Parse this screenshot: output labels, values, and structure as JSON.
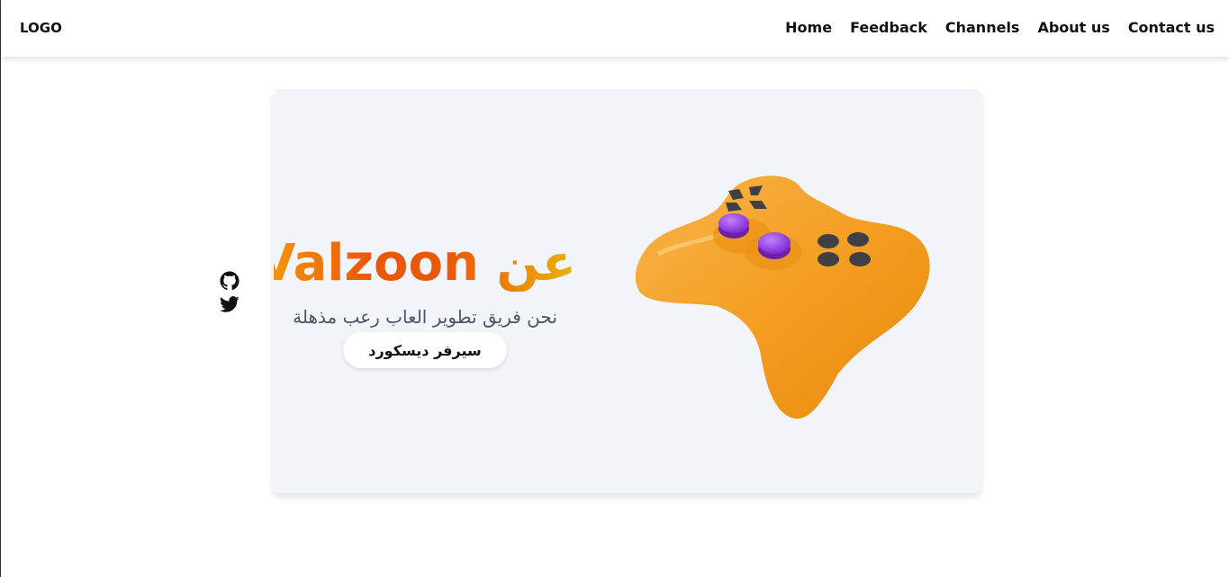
{
  "nav": {
    "logo": "LOGO",
    "items": [
      {
        "label": "Home"
      },
      {
        "label": "Feedback"
      },
      {
        "label": "Channels"
      },
      {
        "label": "About us"
      },
      {
        "label": "Contact us"
      }
    ]
  },
  "hero": {
    "title": "عن Valzoon",
    "subtitle": "نحن فريق تطوير العاب رعب مذهلة",
    "button_label": "سيرفر ديسكورد",
    "gradient_colors": [
      "#f59e0b",
      "#ea580c",
      "#eab308"
    ]
  },
  "social": {
    "icons": [
      "github-icon",
      "twitter-icon"
    ]
  },
  "illustration": {
    "name": "game-controller-illustration",
    "colors": {
      "body": "#f59e0b",
      "buttons": "#9333ea",
      "dark": "#3f3f46"
    }
  },
  "colors": {
    "card_bg": "#f1f4f8",
    "subtitle": "#4b5563"
  }
}
